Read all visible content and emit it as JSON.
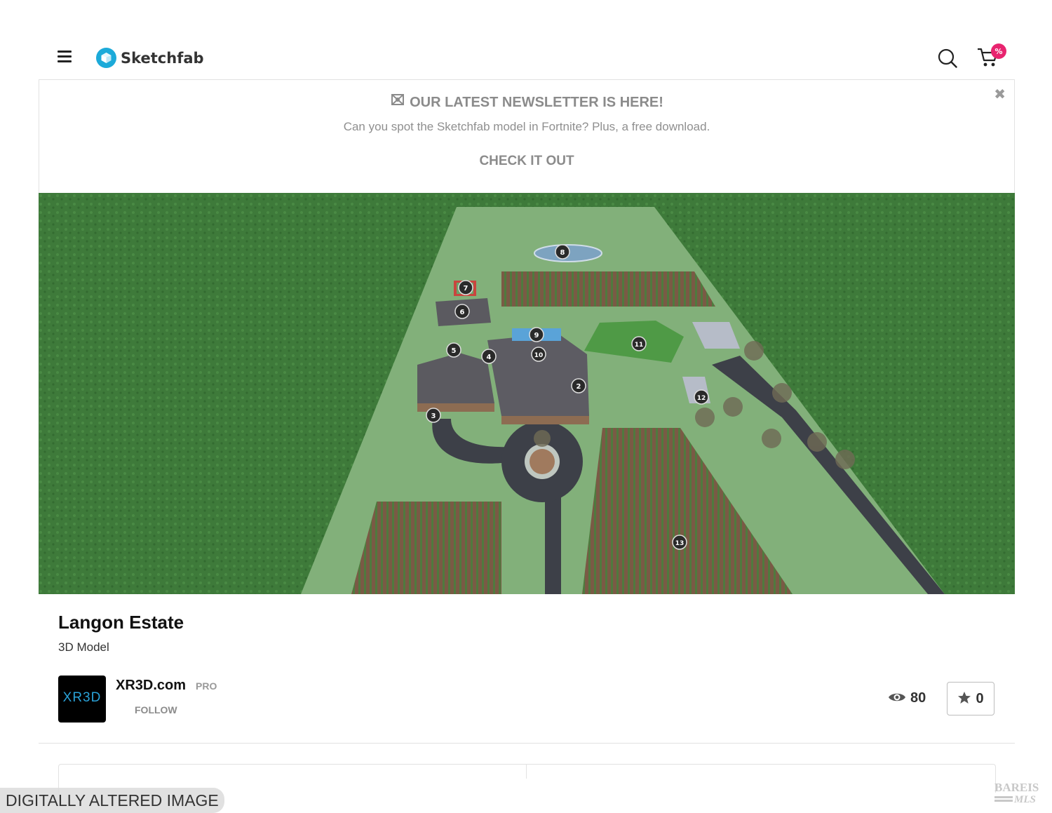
{
  "header": {
    "brand": "Sketchfab",
    "cart_badge": "%"
  },
  "banner": {
    "title": "OUR LATEST NEWSLETTER IS HERE!",
    "subtitle": "Can you spot the Sketchfab model in Fortnite? Plus, a free download.",
    "cta": "CHECK IT OUT",
    "close_glyph": "✖"
  },
  "viewer": {
    "hotspots": [
      "2",
      "3",
      "4",
      "5",
      "6",
      "7",
      "8",
      "9",
      "10",
      "11",
      "12",
      "13"
    ]
  },
  "model": {
    "title": "Langon Estate",
    "type": "3D Model"
  },
  "author": {
    "avatar_text": "XR3D",
    "name": "XR3D.com",
    "badge": "PRO",
    "follow_label": "FOLLOW"
  },
  "stats": {
    "views": "80",
    "likes": "0"
  },
  "overlay": {
    "watermark": "DIGITALLY ALTERED IMAGE",
    "mls_logo_text": "BAREIS MLS"
  },
  "colors": {
    "accent": "#1caad9",
    "badge": "#e8246f",
    "grass": "#3f7a3a",
    "lawn": "#7fae76",
    "road": "#3d4048"
  }
}
